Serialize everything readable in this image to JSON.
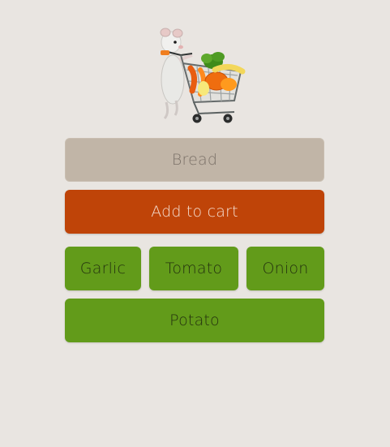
{
  "hero": {
    "image_name": "rat-pushing-shopping-cart"
  },
  "search": {
    "value": "Bread"
  },
  "actions": {
    "add_to_cart_label": "Add to cart"
  },
  "suggestions": [
    {
      "label": "Garlic"
    },
    {
      "label": "Tomato"
    },
    {
      "label": "Onion"
    },
    {
      "label": "Potato"
    }
  ],
  "colors": {
    "background": "#e9e5e1",
    "input_bg": "#c1b5a7",
    "accent": "#bf4408",
    "suggestion_bg": "#629b1a"
  }
}
